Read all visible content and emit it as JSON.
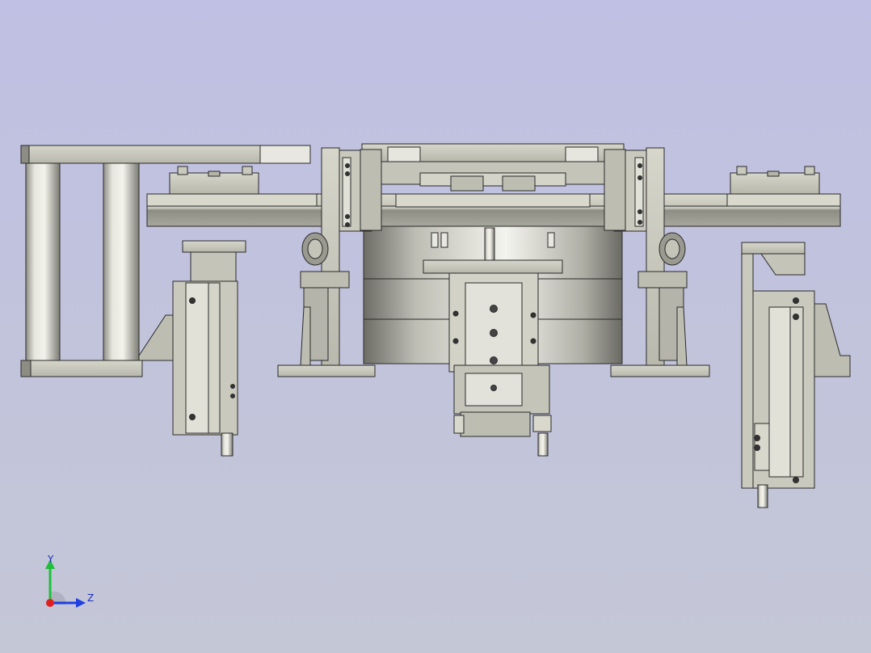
{
  "viewport": {
    "background_top": "#bfc0e3",
    "background_bottom": "#c4c7d6",
    "part_fill": "#c9c9bd",
    "part_dark": "#8d8d84",
    "part_edge": "#2a2a2a"
  },
  "triad": {
    "x_label": "",
    "y_label": "Y",
    "z_label": "Z",
    "colors": {
      "x": "#e02020",
      "y": "#1fbf3a",
      "z": "#2040e0"
    }
  }
}
